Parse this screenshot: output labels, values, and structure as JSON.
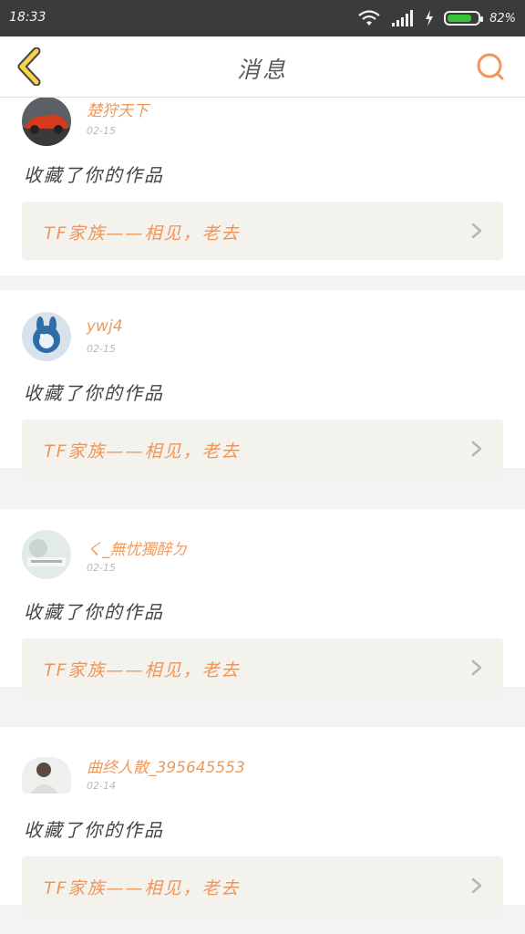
{
  "status_bar": {
    "time": "18:33",
    "battery_percent_text": "82%",
    "battery_level": 0.82
  },
  "header": {
    "title": "消息"
  },
  "messages": [
    {
      "user": "楚狩天下",
      "date": "02-15",
      "action": "收藏了你的作品",
      "work_title": "TF家族——相见，老去",
      "avatar": "red-sports-car-avatar"
    },
    {
      "user": "ywj4",
      "date": "02-15",
      "action": "收藏了你的作品",
      "work_title": "TF家族——相见，老去",
      "avatar": "blue-rabbit-avatar"
    },
    {
      "user": "く_無忧獨醉ㄉ",
      "date": "02-15",
      "action": "收藏了你的作品",
      "work_title": "TF家族——相见，老去",
      "avatar": "pale-photo-avatar"
    },
    {
      "user": "曲终人散_395645553",
      "date": "02-14",
      "action": "收藏了你的作品",
      "work_title": "TF家族——相见，老去",
      "avatar": "portrait-photo-avatar"
    }
  ],
  "colors": {
    "accent": "#f0955a",
    "status_bar": "#3b3b3b",
    "battery": "#36c436",
    "card_box": "#f3f2ec"
  }
}
